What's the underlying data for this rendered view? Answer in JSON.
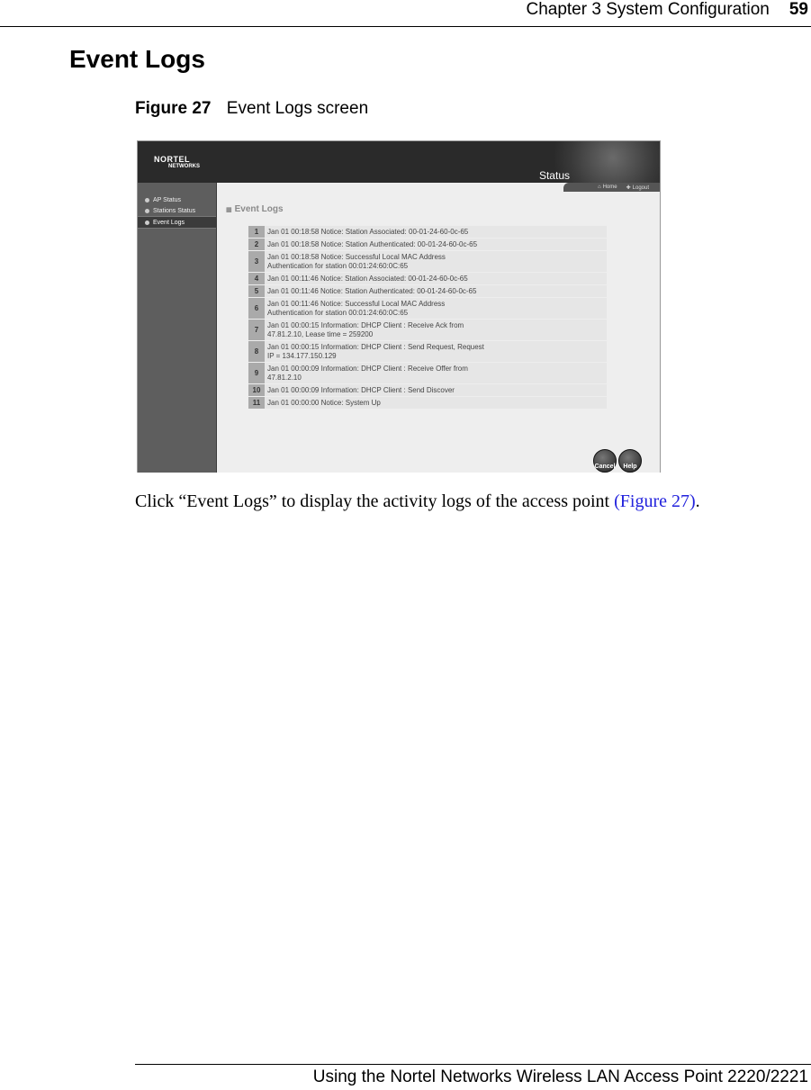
{
  "running_head": {
    "chapter": "Chapter 3  System Configuration",
    "page_number": "59"
  },
  "section_title": "Event Logs",
  "figure": {
    "number": "Figure 27",
    "caption": "Event Logs screen"
  },
  "screenshot": {
    "logo": {
      "line1": "NORTEL",
      "line2": "NETWORKS"
    },
    "header_title": "Status",
    "top_nav": {
      "home": "Home",
      "logout": "Logout"
    },
    "sidebar": {
      "items": [
        {
          "label": "AP Status",
          "active": false
        },
        {
          "label": "Stations Status",
          "active": false
        },
        {
          "label": "Event Logs",
          "active": true
        }
      ]
    },
    "content_title": "Event Logs",
    "logs": [
      {
        "num": "1",
        "text": "Jan 01 00:18:58 Notice: Station Associated: 00-01-24-60-0c-65"
      },
      {
        "num": "2",
        "text": "Jan 01 00:18:58 Notice: Station Authenticated: 00-01-24-60-0c-65"
      },
      {
        "num": "3",
        "text": "Jan 01 00:18:58 Notice: Successful Local MAC Address\nAuthentication for station 00:01:24:60:0C:65"
      },
      {
        "num": "4",
        "text": "Jan 01 00:11:46 Notice: Station Associated: 00-01-24-60-0c-65"
      },
      {
        "num": "5",
        "text": "Jan 01 00:11:46 Notice: Station Authenticated: 00-01-24-60-0c-65"
      },
      {
        "num": "6",
        "text": "Jan 01 00:11:46 Notice: Successful Local MAC Address\nAuthentication for station 00:01:24:60:0C:65"
      },
      {
        "num": "7",
        "text": "Jan 01 00:00:15 Information: DHCP Client : Receive Ack from\n47.81.2.10, Lease time = 259200"
      },
      {
        "num": "8",
        "text": "Jan 01 00:00:15 Information: DHCP Client : Send Request, Request\nIP = 134.177.150.129"
      },
      {
        "num": "9",
        "text": "Jan 01 00:00:09 Information: DHCP Client : Receive Offer from\n47.81.2.10"
      },
      {
        "num": "10",
        "text": "Jan 01 00:00:09 Information: DHCP Client : Send Discover"
      },
      {
        "num": "11",
        "text": "Jan 01 00:00:00 Notice: System Up"
      }
    ],
    "buttons": {
      "cancel": "Cancel",
      "help": "Help"
    }
  },
  "body": {
    "text": "Click “Event Logs” to display the activity logs of the access point ",
    "xref": "(Figure 27)",
    "end": "."
  },
  "footer": {
    "text": "Using the Nortel Networks Wireless LAN Access Point 2220/2221"
  }
}
